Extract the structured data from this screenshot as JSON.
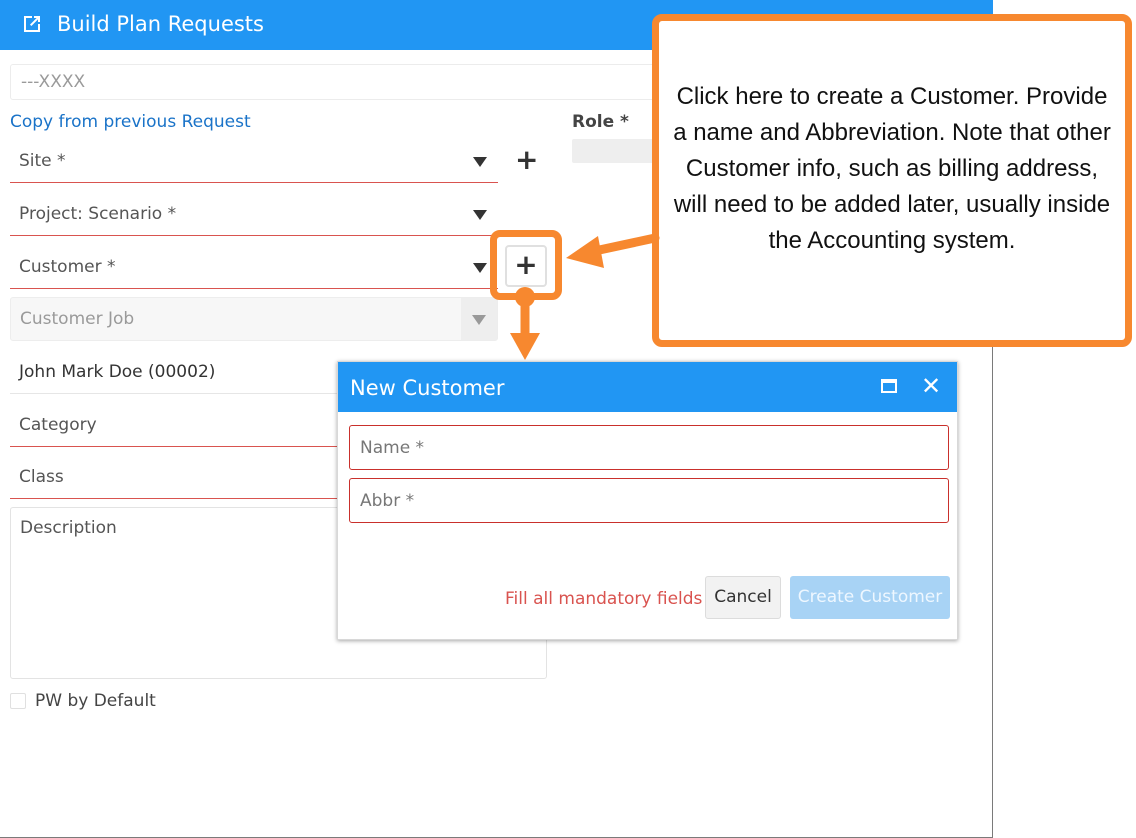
{
  "header": {
    "title": "Build Plan Requests",
    "icon": "external-link-icon"
  },
  "form": {
    "top_input_placeholder": "---XXXX",
    "copy_link": "Copy from previous Request",
    "role_label": "Role *",
    "site_label": "Site *",
    "project_label": "Project: Scenario *",
    "customer_label": "Customer *",
    "customer_job_label": "Customer Job",
    "person": "John Mark Doe (00002)",
    "category_label": "Category",
    "class_label": "Class",
    "description_label": "Description",
    "pw_default_label": "PW by Default",
    "add_symbol": "+"
  },
  "dialog": {
    "title": "New Customer",
    "name_placeholder": "Name *",
    "abbr_placeholder": "Abbr *",
    "warning": "Fill all mandatory fields",
    "cancel_label": "Cancel",
    "create_label": "Create Customer",
    "close_symbol": "✕"
  },
  "callout": {
    "text": "Click here to create a Customer. Provide a name and Abbreviation. Note that other Customer info, such as billing address, will need to be added later, usually inside the Accounting system.",
    "color": "#f7882f"
  },
  "colors": {
    "accent": "#2196f3",
    "error": "#d9534f",
    "callout": "#f7882f"
  }
}
